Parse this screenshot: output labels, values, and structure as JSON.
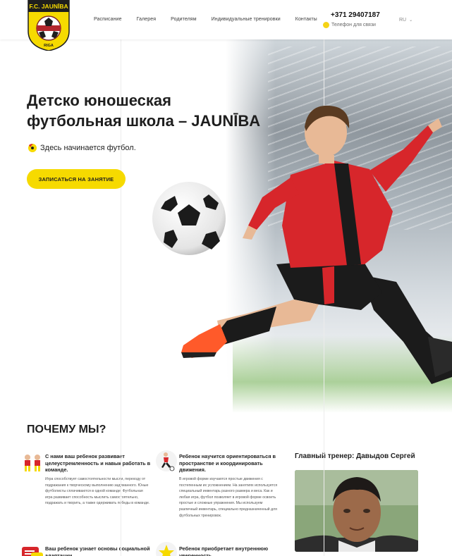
{
  "header": {
    "logo": {
      "top_text": "F.C. JAUNĪBA",
      "bottom_text": "RIGA"
    },
    "nav": [
      "Расписание",
      "Галерея",
      "Родителям",
      "Индивидуальные тренировки",
      "Контакты"
    ],
    "phone": "+371 29407187",
    "phone_sub": "Телефон для связи",
    "lang": "RU"
  },
  "hero": {
    "title_line1": "Детско юношеская",
    "title_line2": "футбольная школа – JAUNĪBA",
    "tagline": "Здесь начинается футбол.",
    "cta": "ЗАПИСАТЬСЯ НА ЗАНЯТИЕ"
  },
  "why": {
    "title": "ПОЧЕМУ МЫ?",
    "features": [
      {
        "icon": "team-icon",
        "head": "С нами ваш ребенок развивает целеустремленность и навык работать в команде.",
        "text": "Игра способствует самостоятельности мысли, переходу от подражания к творческому выполнению задуманного. Юные футболисты сплачиваются в одной команде. Футбольная игра развивает способность мыслить самостоятельно, подражать и творить, а также одерживать победы в команде."
      },
      {
        "icon": "running-player-icon",
        "head": "Ребенок научится ориентироваться в пространстве и координировать движения.",
        "text": "В игровой форме изучаются простые движения с постепенным их усложнением. На занятиях используется специальный инвентарь разного размера и веса. Как и любая игра, футбол позволяет в игровой форме освоить простые и сложные упражнения. Мы используем различный инвентарь, специально предназначенный для футбольных тренировок."
      },
      {
        "icon": "chat-icon",
        "head": "Ваш ребенок узнает основы социальной адаптации.",
        "text": ""
      },
      {
        "icon": "star-icon",
        "head": "Ребенок приобретает внутреннюю уверенность.",
        "text": ""
      }
    ]
  },
  "coach": {
    "title": "Главный тренер: Давыдов Сергей"
  },
  "colors": {
    "accent": "#f6da00",
    "kit_red": "#d7262b",
    "text": "#1e1e1e"
  }
}
